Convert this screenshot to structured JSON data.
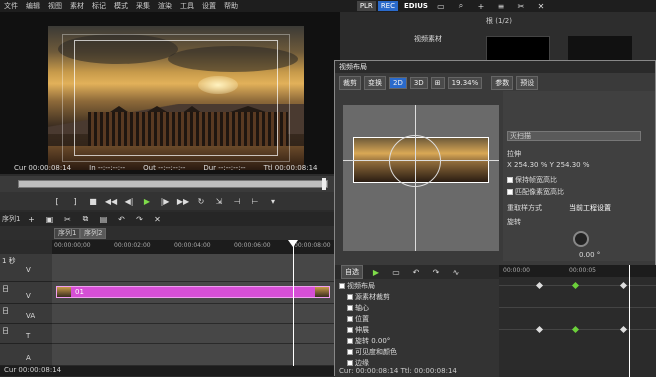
{
  "menu": [
    "文件",
    "编辑",
    "视图",
    "素材",
    "标记",
    "模式",
    "采集",
    "渲染",
    "工具",
    "设置",
    "帮助"
  ],
  "recorder": {
    "plr": "PLR",
    "rec": "REC"
  },
  "player": {
    "cur": "Cur 00:00:08:14",
    "in": "In --:--:--:--",
    "out": "Out --:--:--:--",
    "dur": "Dur --:--:--:--",
    "ttl": "Ttl 00:00:08:14"
  },
  "timeline": {
    "toolbar_label": "序列1",
    "tabs": [
      "序列1",
      "序列2"
    ],
    "ruler": [
      "00:00:00;00",
      "00:00:02:00",
      "00:00:04:00",
      "00:00:06:00",
      "00:00:08:00"
    ],
    "tracks": [
      {
        "name": "1 秒",
        "icon": "V"
      },
      {
        "name": "日",
        "icon": "V"
      },
      {
        "name": "日",
        "icon": "VA"
      },
      {
        "name": "日",
        "icon": "T"
      },
      {
        "name": "",
        "icon": "A"
      }
    ],
    "clip_label": "01",
    "status": "Cur 00:00:08:14"
  },
  "bin": {
    "title": "EDIUS",
    "page": "根 (1/2)",
    "folder_label": "视频素材"
  },
  "dialog": {
    "title": "视频布局",
    "tab_crop": "裁剪",
    "tab_transform": "变换",
    "mode2d": "2D",
    "mode3d": "3D",
    "zoom": "19.34%",
    "param_tab": "参数",
    "preset_tab": "预设",
    "scan_mode": "灭扫描",
    "stretch_label": "拉伸",
    "stretch_values": "X  254.30 %  Y  254.30 %",
    "keep_ratio": "保持帧宽高比",
    "pixel_ratio": "匹配像素宽高比",
    "resample_label": "重取样方式",
    "resample_value": "当前工程设置",
    "rotate_label": "旋转",
    "rotate_value": "0.00 °",
    "kf_tab": "自选",
    "kf_items": [
      "视频布局",
      "源素材裁剪",
      "轴心",
      "位置",
      "伸展",
      "旋转 0.00°",
      "可见度和颜色",
      "边缘"
    ],
    "kf_ruler": [
      "00:00:00",
      "00:00:05"
    ],
    "status": "Cur: 00:00:08:14   Ttl: 00:00:08:14"
  }
}
